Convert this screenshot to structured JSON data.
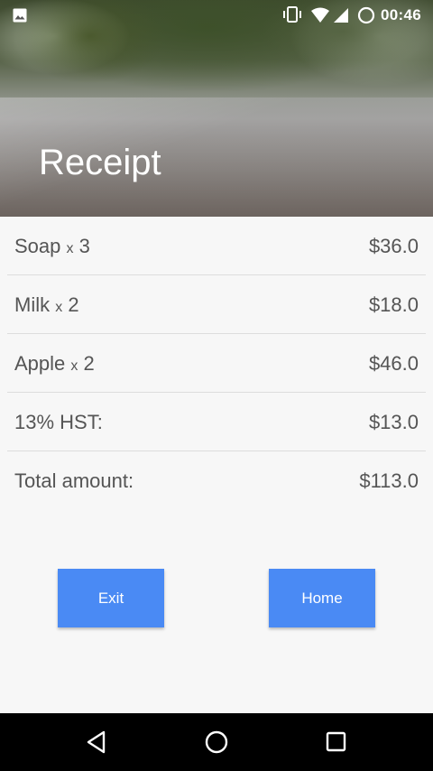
{
  "status_bar": {
    "time": "00:46",
    "icons": [
      "image-icon",
      "vibrate-icon",
      "wifi-icon",
      "signal-icon",
      "sync-icon"
    ]
  },
  "header": {
    "title": "Receipt"
  },
  "receipt": {
    "items": [
      {
        "name": "Soap",
        "qty_x": "x",
        "qty": "3",
        "price": "$36.0"
      },
      {
        "name": "Milk",
        "qty_x": "x",
        "qty": "2",
        "price": "$18.0"
      },
      {
        "name": "Apple",
        "qty_x": "x",
        "qty": "2",
        "price": "$46.0"
      }
    ],
    "tax": {
      "label": "13% HST:",
      "value": "$13.0"
    },
    "total": {
      "label": "Total amount:",
      "value": "$113.0"
    }
  },
  "buttons": {
    "exit_label": "Exit",
    "home_label": "Home"
  },
  "nav_bar": {
    "icons": [
      "back-icon",
      "home-icon",
      "recents-icon"
    ]
  },
  "colors": {
    "button": "#4a8af4",
    "text": "#555555",
    "background": "#f7f7f7"
  }
}
